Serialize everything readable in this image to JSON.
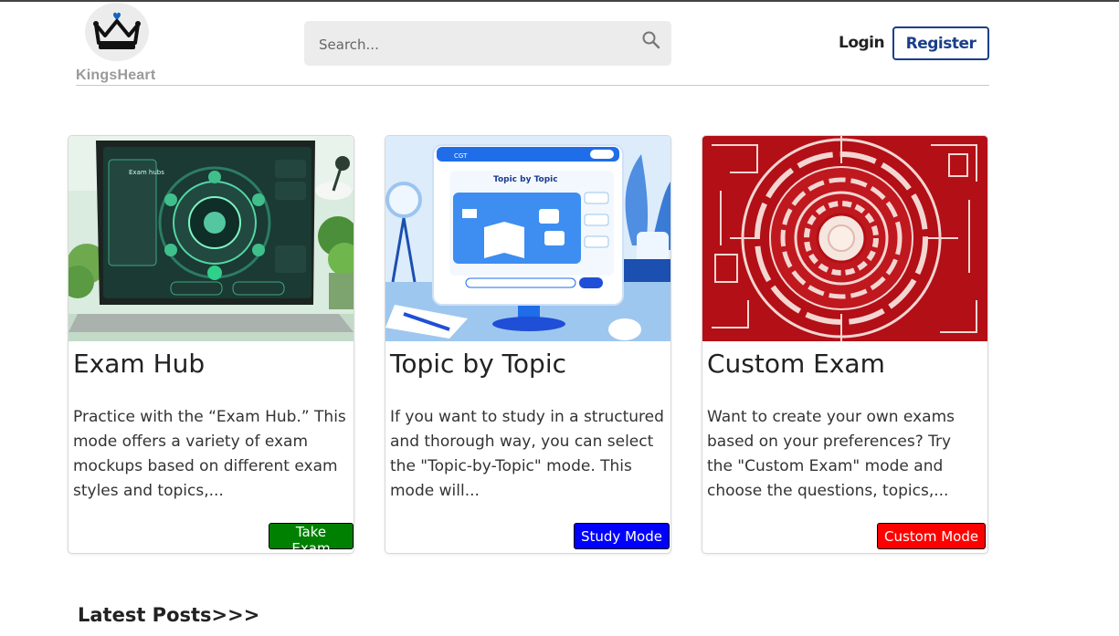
{
  "brand": {
    "name": "KingsHeart",
    "logo_icon": "crown-heart-icon"
  },
  "search": {
    "placeholder": "Search...",
    "value": "",
    "icon": "search-icon"
  },
  "nav": {
    "login_label": "Login",
    "register_label": "Register"
  },
  "cards": [
    {
      "title": "Exam Hub",
      "text": "Practice with the “Exam Hub.” This mode offers a variety of exam mockups based on different exam styles and topics,...",
      "button_label": "Take Exam",
      "button_color": "#008000",
      "image": "laptop-exam-hub-illustration"
    },
    {
      "title": "Topic by Topic",
      "text": "If you want to study in a structured and thorough way, you can select the \"Topic-by-Topic\" mode. This mode will...",
      "button_label": "Study Mode",
      "button_color": "#0000ff",
      "image": "monitor-topic-by-topic-illustration"
    },
    {
      "title": "Custom Exam",
      "text": "Want to create your own exams based on your preferences? Try the \"Custom Exam\" mode and choose the questions, topics,...",
      "button_label": "Custom Mode",
      "button_color": "#ff0000",
      "image": "red-circuit-illustration"
    }
  ],
  "image_text": {
    "laptop_title": "Exam hubs",
    "monitor_tab": "CGT",
    "monitor_title": "Topic by Topic"
  },
  "latest_posts": {
    "heading": "Latest Posts>>>"
  }
}
